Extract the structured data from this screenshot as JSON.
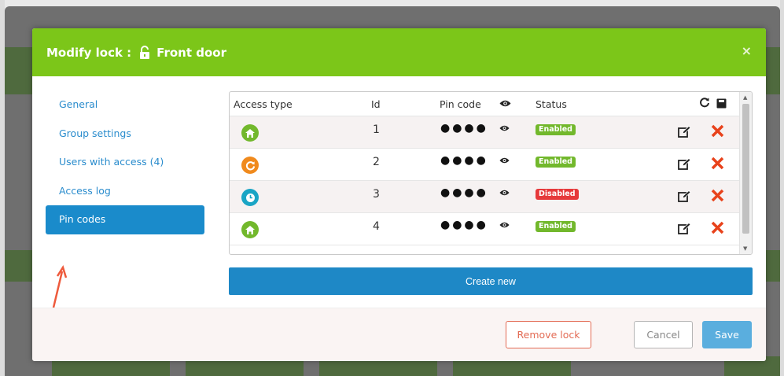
{
  "modal": {
    "title_prefix": "Modify lock :",
    "lock_name": "Front door",
    "close_symbol": "×"
  },
  "sidebar": {
    "items": [
      {
        "label": "General"
      },
      {
        "label": "Group settings"
      },
      {
        "label": "Users with access (4)"
      },
      {
        "label": "Access log"
      },
      {
        "label": "Pin codes"
      }
    ],
    "active_index": 4
  },
  "table": {
    "headers": {
      "access_type": "Access type",
      "id": "Id",
      "pin_code": "Pin code",
      "status": "Status"
    },
    "rows": [
      {
        "type_icon": "home-icon",
        "icon_color": "#72b82c",
        "id": "1",
        "pin": "●●●●",
        "status": "Enabled"
      },
      {
        "type_icon": "refresh-icon",
        "icon_color": "#f08a1d",
        "id": "2",
        "pin": "●●●●",
        "status": "Enabled"
      },
      {
        "type_icon": "clock-icon",
        "icon_color": "#1aa5c5",
        "id": "3",
        "pin": "●●●●",
        "status": "Disabled"
      },
      {
        "type_icon": "home-icon",
        "icon_color": "#72b82c",
        "id": "4",
        "pin": "●●●●",
        "status": "Enabled"
      }
    ]
  },
  "buttons": {
    "create_new": "Create new",
    "remove_lock": "Remove lock",
    "cancel": "Cancel",
    "save": "Save"
  },
  "colors": {
    "header_green": "#7cc619",
    "primary_blue": "#1e88c6",
    "enabled": "#72b82c",
    "disabled": "#e6393b",
    "delete_red": "#e8421b"
  }
}
